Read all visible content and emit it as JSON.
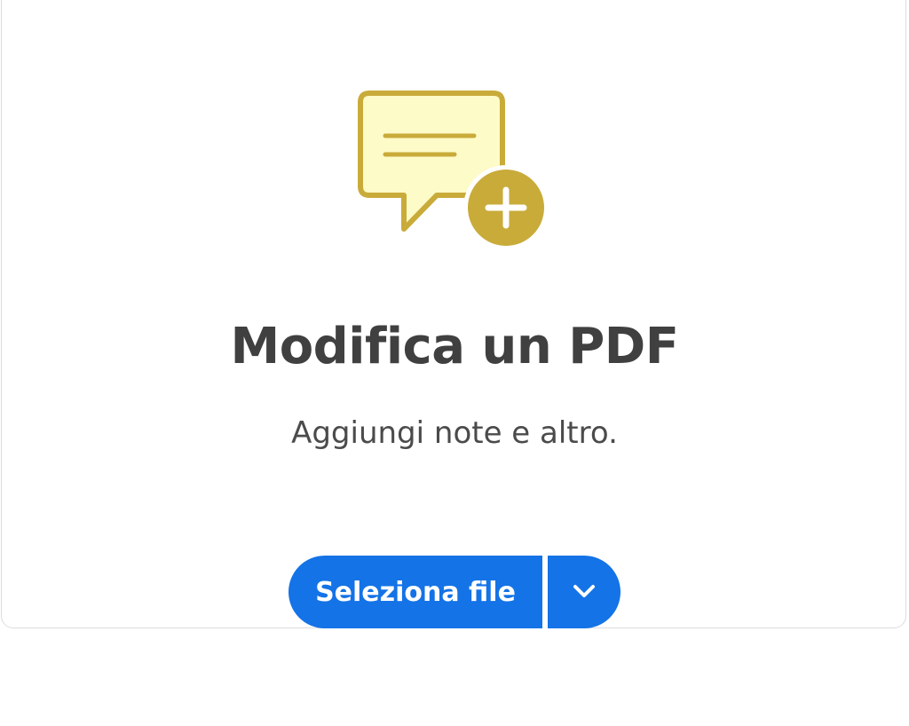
{
  "main": {
    "title": "Modifica un PDF",
    "subtitle": "Aggiungi note e altro.",
    "select_button_label": "Seleziona file",
    "dropdown_icon": "chevron-down-icon",
    "hero_icon": "comment-add-icon"
  },
  "colors": {
    "accent": "#1473e6",
    "icon_fill": "#fdfbc7",
    "icon_stroke": "#c9ab3a",
    "text": "#404040"
  }
}
